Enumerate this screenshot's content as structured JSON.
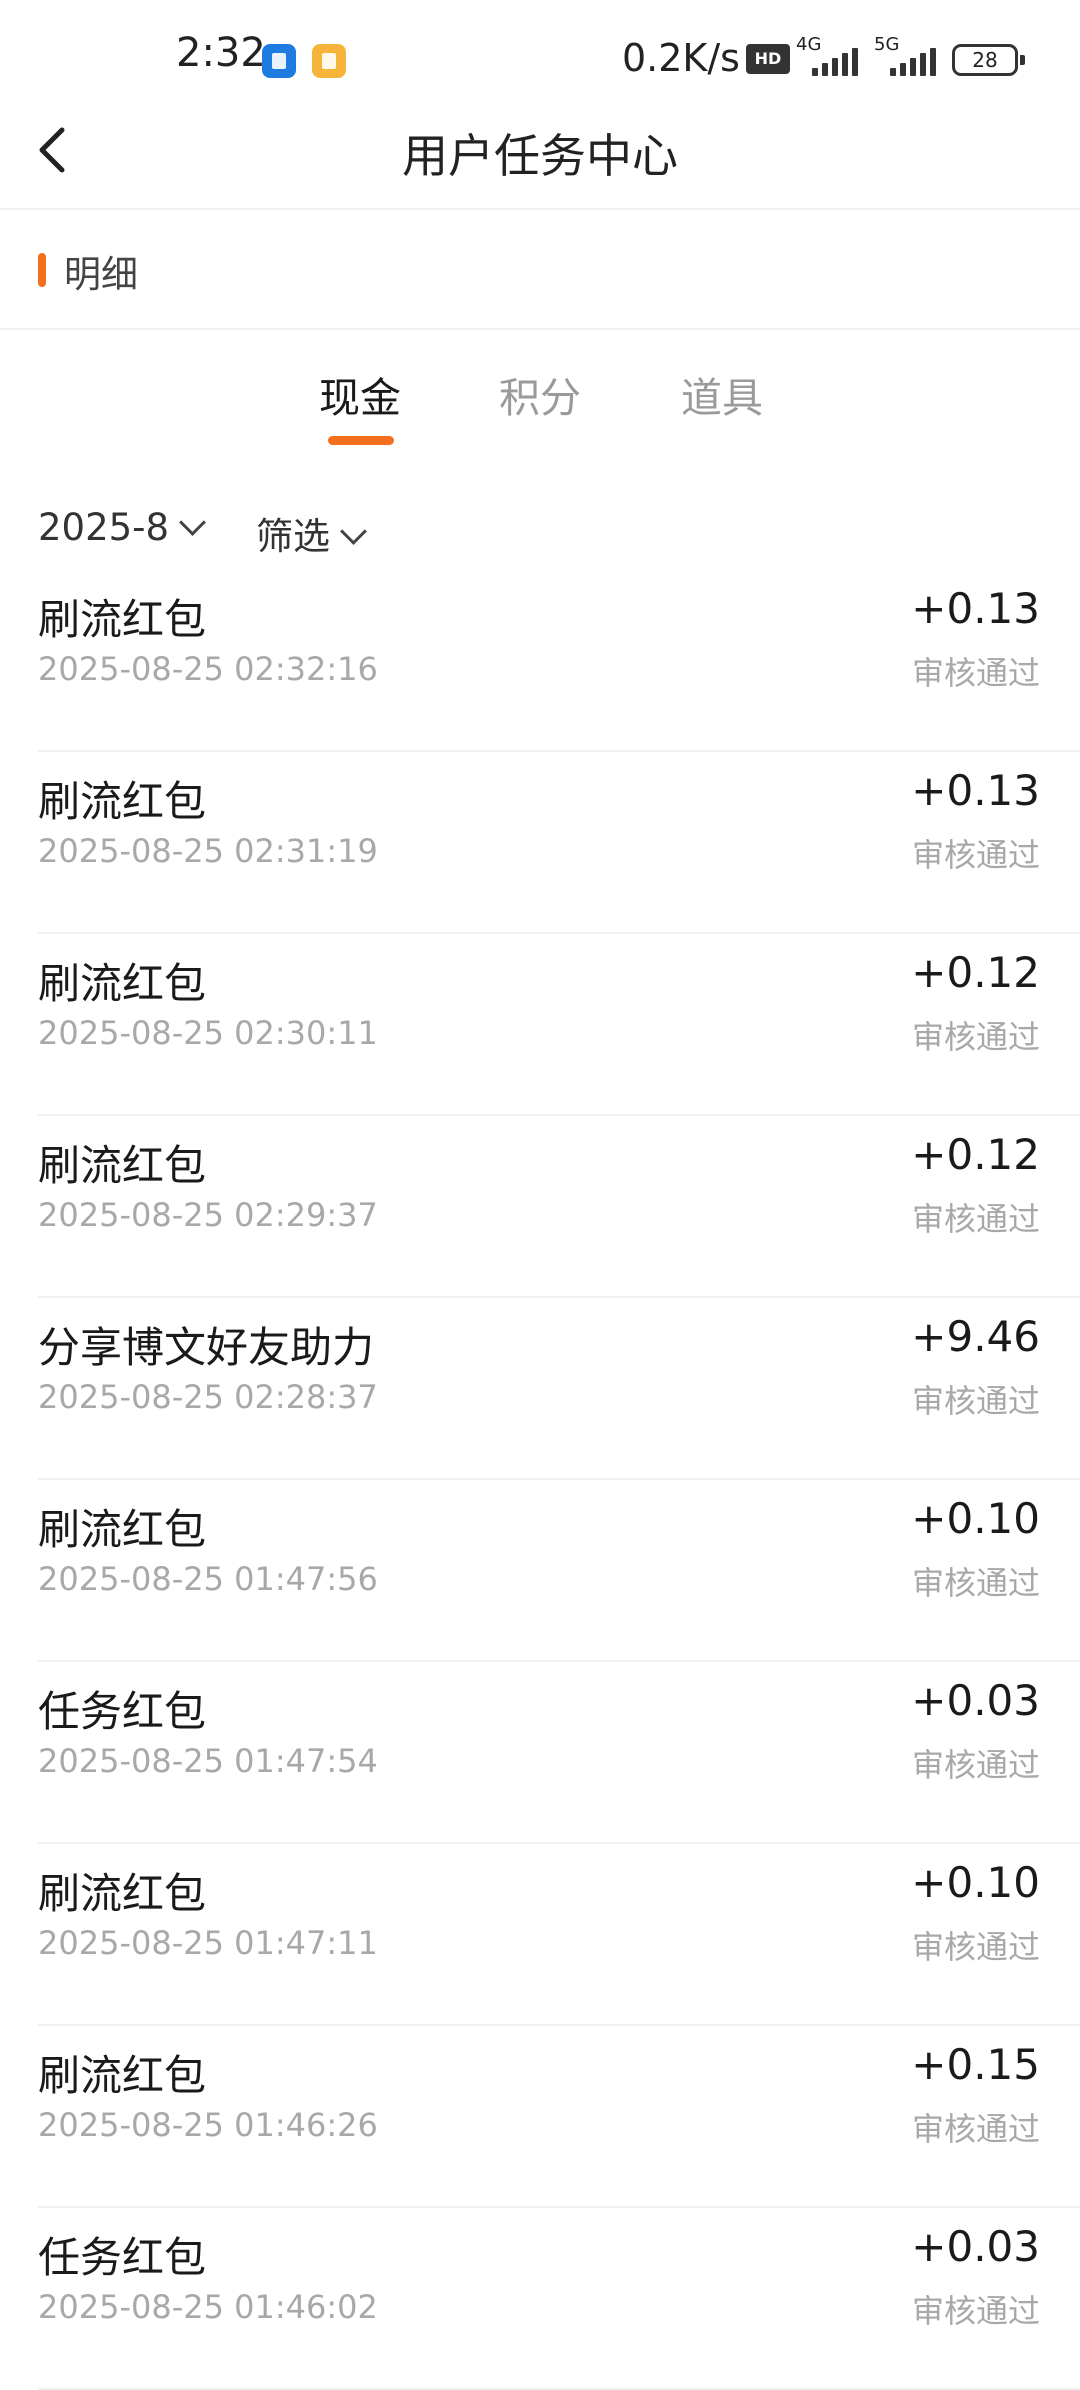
{
  "status_bar": {
    "time": "2:32",
    "net_speed": "0.2K/s",
    "hd_label": "HD",
    "network_1": "4G",
    "network_2": "5G",
    "battery": "28"
  },
  "nav": {
    "title": "用户任务中心",
    "back_icon": "chevron-left-icon"
  },
  "section": {
    "title": "明细"
  },
  "tabs": [
    {
      "label": "现金",
      "active": true
    },
    {
      "label": "积分",
      "active": false
    },
    {
      "label": "道具",
      "active": false
    }
  ],
  "filters": {
    "month": "2025-8",
    "filter_label": "筛选"
  },
  "records": [
    {
      "title": "刷流红包",
      "time": "2025-08-25 02:32:16",
      "amount": "+0.13",
      "status": "审核通过"
    },
    {
      "title": "刷流红包",
      "time": "2025-08-25 02:31:19",
      "amount": "+0.13",
      "status": "审核通过"
    },
    {
      "title": "刷流红包",
      "time": "2025-08-25 02:30:11",
      "amount": "+0.12",
      "status": "审核通过"
    },
    {
      "title": "刷流红包",
      "time": "2025-08-25 02:29:37",
      "amount": "+0.12",
      "status": "审核通过"
    },
    {
      "title": "分享博文好友助力",
      "time": "2025-08-25 02:28:37",
      "amount": "+9.46",
      "status": "审核通过"
    },
    {
      "title": "刷流红包",
      "time": "2025-08-25 01:47:56",
      "amount": "+0.10",
      "status": "审核通过"
    },
    {
      "title": "任务红包",
      "time": "2025-08-25 01:47:54",
      "amount": "+0.03",
      "status": "审核通过"
    },
    {
      "title": "刷流红包",
      "time": "2025-08-25 01:47:11",
      "amount": "+0.10",
      "status": "审核通过"
    },
    {
      "title": "刷流红包",
      "time": "2025-08-25 01:46:26",
      "amount": "+0.15",
      "status": "审核通过"
    },
    {
      "title": "任务红包",
      "time": "2025-08-25 01:46:02",
      "amount": "+0.03",
      "status": "审核通过"
    }
  ],
  "colors": {
    "accent": "#f36f1d"
  }
}
